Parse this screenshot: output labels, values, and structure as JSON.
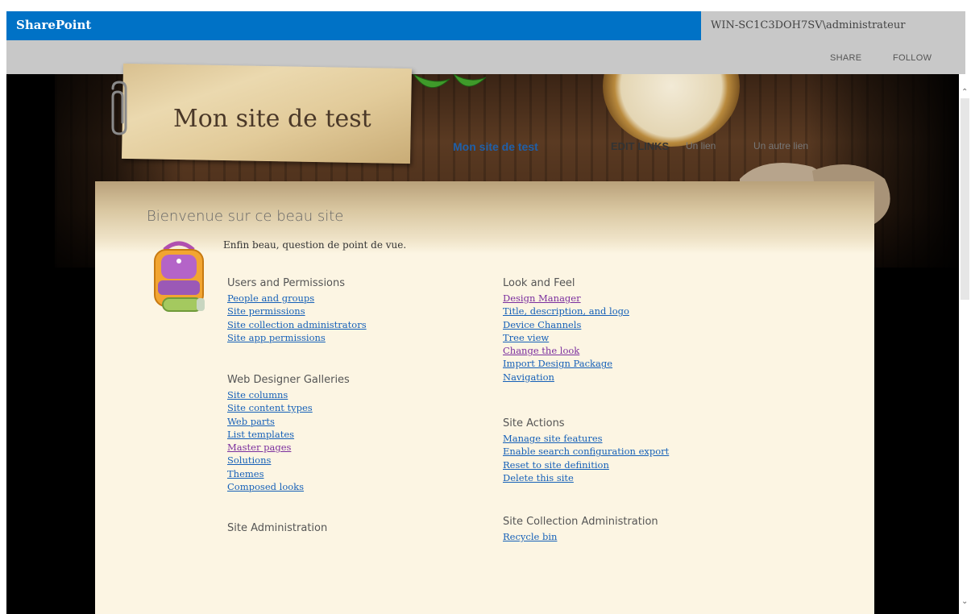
{
  "suite_bar": {
    "brand": "SharePoint",
    "user": "WIN-SC1C3DOH7SV\\administrateur"
  },
  "ribbon": {
    "share": "SHARE",
    "follow": "FOLLOW"
  },
  "header": {
    "site_title": "Mon site de test",
    "nav": {
      "current": "Mon site de test",
      "edit_links": "EDIT LINKS",
      "links": [
        "Un lien",
        "Un autre lien"
      ]
    }
  },
  "main": {
    "welcome": "Bienvenue sur ce beau site",
    "tagline": "Enfin beau, question de point de vue.",
    "sections": {
      "users_permissions": {
        "heading": "Users and Permissions",
        "links": [
          "People and groups",
          "Site permissions",
          "Site collection administrators",
          "Site app permissions"
        ]
      },
      "web_designer_galleries": {
        "heading": "Web Designer Galleries",
        "links": [
          "Site columns",
          "Site content types",
          "Web parts",
          "List templates",
          "Master pages",
          "Solutions",
          "Themes",
          "Composed looks"
        ]
      },
      "site_administration": {
        "heading": "Site Administration",
        "links": []
      },
      "look_and_feel": {
        "heading": "Look and Feel",
        "links": [
          "Design Manager",
          "Title, description, and logo",
          "Device Channels",
          "Tree view",
          "Change the look",
          "Import Design Package",
          "Navigation"
        ]
      },
      "site_actions": {
        "heading": "Site Actions",
        "links": [
          "Manage site features",
          "Enable search configuration export",
          "Reset to site definition",
          "Delete this site"
        ]
      },
      "site_collection_administration": {
        "heading": "Site Collection Administration",
        "links": [
          "Recycle bin"
        ]
      }
    }
  },
  "colors": {
    "suite_blue": "#0072c6",
    "link": "#1560b8",
    "visited_link": "#7a2e9e",
    "parchment": "#fcf5e3"
  }
}
